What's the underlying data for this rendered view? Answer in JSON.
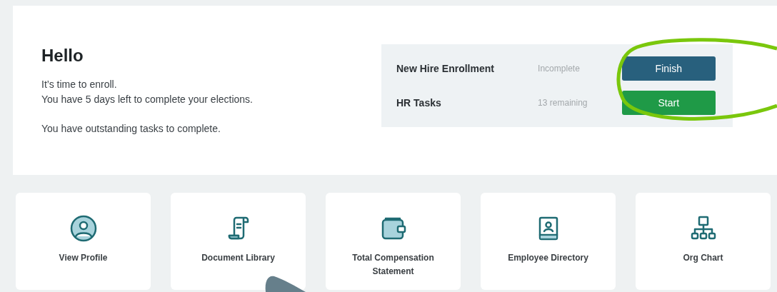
{
  "greeting": {
    "title": "Hello",
    "lines": [
      "It’s time to enroll.",
      "You have 5 days left to complete your elections."
    ],
    "note": "You have outstanding tasks to complete."
  },
  "tasks": [
    {
      "name": "New Hire Enrollment",
      "status": "Incomplete",
      "action": "Finish",
      "kind": "finish"
    },
    {
      "name": "HR Tasks",
      "status": "13 remaining",
      "action": "Start",
      "kind": "start"
    }
  ],
  "tiles": [
    {
      "label": "View Profile",
      "kind": "profile"
    },
    {
      "label": "Document Library",
      "kind": "scroll"
    },
    {
      "label": "Total Compensation Statement",
      "kind": "wallet"
    },
    {
      "label": "Employee Directory",
      "kind": "directory"
    },
    {
      "label": "Org Chart",
      "kind": "org"
    }
  ]
}
